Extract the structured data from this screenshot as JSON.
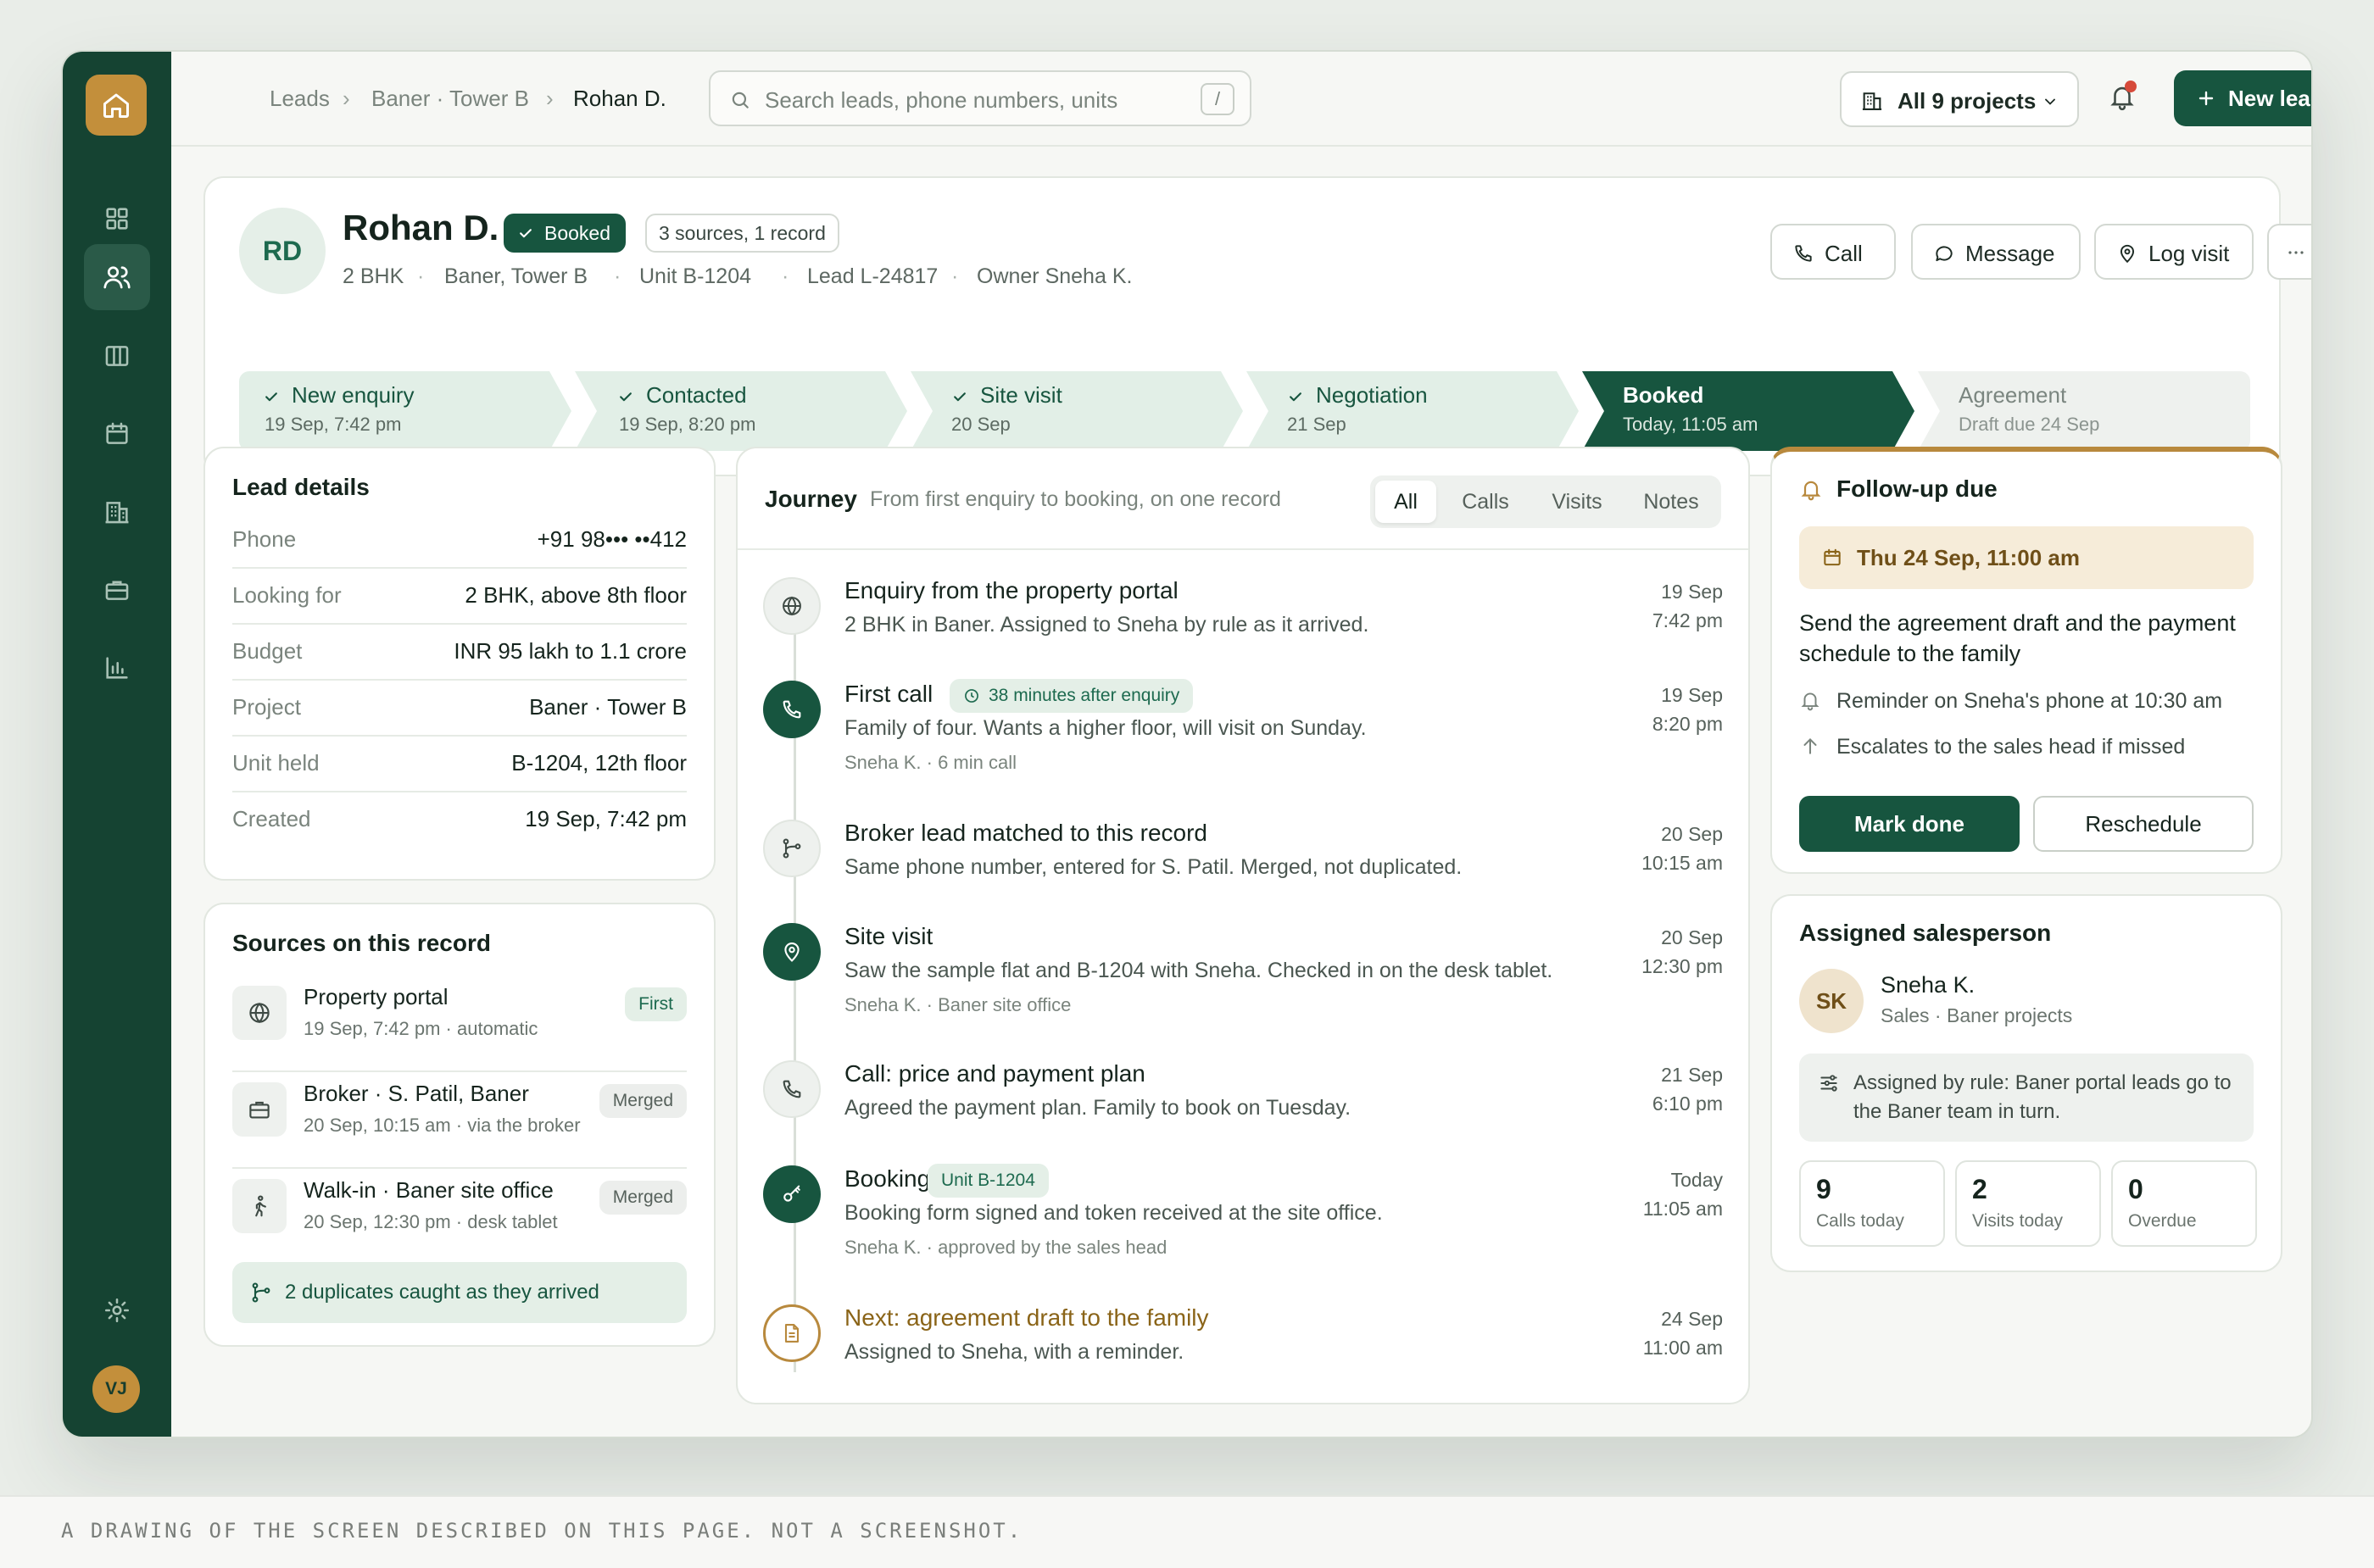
{
  "breadcrumb": [
    "Leads",
    "Baner · Tower B",
    "Rohan D."
  ],
  "search": {
    "placeholder": "Search leads, phone numbers, units",
    "shortcut": "/"
  },
  "projects_button": "All 9 projects",
  "new_lead_button": "New lead",
  "sidebar": {
    "icons": [
      "home-icon",
      "dashboard-icon",
      "leads-icon",
      "board-icon",
      "calendar-icon",
      "building-icon",
      "briefcase-icon",
      "chart-icon",
      "settings-icon"
    ],
    "active": "leads-icon",
    "avatar": "VJ"
  },
  "colors": {
    "brand": "#17553f",
    "rail": "#154332",
    "accent_gold": "#c38f3b",
    "alert": "#d64a3a"
  },
  "lead": {
    "initials": "RD",
    "name": "Rohan D.",
    "status": "Booked",
    "sources_badge": "3 sources, 1 record",
    "meta": [
      "2 BHK",
      "Baner, Tower B",
      "Unit B-1204",
      "Lead L-24817",
      "Owner Sneha K."
    ],
    "actions": [
      "Call",
      "Message",
      "Log visit"
    ]
  },
  "stages": [
    {
      "label": "New enquiry",
      "sub": "19 Sep, 7:42 pm",
      "state": "done"
    },
    {
      "label": "Contacted",
      "sub": "19 Sep, 8:20 pm",
      "state": "done"
    },
    {
      "label": "Site visit",
      "sub": "20 Sep",
      "state": "done"
    },
    {
      "label": "Negotiation",
      "sub": "21 Sep",
      "state": "done"
    },
    {
      "label": "Booked",
      "sub": "Today, 11:05 am",
      "state": "current"
    },
    {
      "label": "Agreement",
      "sub": "Draft due 24 Sep",
      "state": "future"
    }
  ],
  "lead_details": {
    "title": "Lead details",
    "rows": [
      {
        "k": "Phone",
        "v": "+91 98••• ••412"
      },
      {
        "k": "Looking for",
        "v": "2 BHK, above 8th floor"
      },
      {
        "k": "Budget",
        "v": "INR 95 lakh to 1.1 crore"
      },
      {
        "k": "Project",
        "v": "Baner · Tower B"
      },
      {
        "k": "Unit held",
        "v": "B-1204, 12th floor"
      },
      {
        "k": "Created",
        "v": "19 Sep, 7:42 pm"
      }
    ]
  },
  "sources": {
    "title": "Sources on this record",
    "items": [
      {
        "title": "Property portal",
        "sub": "19 Sep, 7:42 pm · automatic",
        "tag": "First",
        "icon": "globe-icon"
      },
      {
        "title": "Broker · S. Patil, Baner",
        "sub": "20 Sep, 10:15 am · via the broker",
        "tag": "Merged",
        "icon": "briefcase-icon"
      },
      {
        "title": "Walk-in · Baner site office",
        "sub": "20 Sep, 12:30 pm · desk tablet",
        "tag": "Merged",
        "icon": "walk-icon"
      }
    ],
    "duplicates_note": "2 duplicates caught as they arrived"
  },
  "journey": {
    "title": "Journey",
    "subtitle": "From first enquiry to booking, on one record",
    "tabs": [
      "All",
      "Calls",
      "Visits",
      "Notes"
    ],
    "active_tab": "All",
    "events": [
      {
        "title": "Enquiry from the property portal",
        "desc": "2 BHK in Baner. Assigned to Sneha by rule as it arrived.",
        "meta": "",
        "date": "19 Sep",
        "time": "7:42 pm",
        "chip": ""
      },
      {
        "title": "First call",
        "desc": "Family of four. Wants a higher floor, will visit on Sunday.",
        "meta": "Sneha K. · 6 min call",
        "date": "19 Sep",
        "time": "8:20 pm",
        "chip": "38 minutes after enquiry"
      },
      {
        "title": "Broker lead matched to this record",
        "desc": "Same phone number, entered for S. Patil. Merged, not duplicated.",
        "meta": "",
        "date": "20 Sep",
        "time": "10:15 am",
        "chip": ""
      },
      {
        "title": "Site visit",
        "desc": "Saw the sample flat and B-1204 with Sneha. Checked in on the desk tablet.",
        "meta": "Sneha K. · Baner site office",
        "date": "20 Sep",
        "time": "12:30 pm",
        "chip": ""
      },
      {
        "title": "Call: price and payment plan",
        "desc": "Agreed the payment plan. Family to book on Tuesday.",
        "meta": "",
        "date": "21 Sep",
        "time": "6:10 pm",
        "chip": ""
      },
      {
        "title": "Booking",
        "desc": "Booking form signed and token received at the site office.",
        "meta": "Sneha K. · approved by the sales head",
        "date": "Today",
        "time": "11:05 am",
        "chip": "Unit B-1204"
      },
      {
        "title": "Next: agreement draft to the family",
        "desc": "Assigned to Sneha, with a reminder.",
        "meta": "",
        "date": "24 Sep",
        "time": "11:00 am",
        "chip": ""
      }
    ]
  },
  "followup": {
    "title": "Follow-up due",
    "date": "Thu 24 Sep, 11:00 am",
    "body": "Send the agreement draft and the payment schedule to the family",
    "reminder": "Reminder on Sneha's phone at 10:30 am",
    "escalate": "Escalates to the sales head if missed",
    "done": "Mark done",
    "reschedule": "Reschedule"
  },
  "assigned": {
    "title": "Assigned salesperson",
    "initials": "SK",
    "name": "Sneha K.",
    "role": "Sales · Baner projects",
    "rule": "Assigned by rule: Baner portal leads go to the Baner team in turn.",
    "stats": [
      {
        "n": "9",
        "l": "Calls today"
      },
      {
        "n": "2",
        "l": "Visits today"
      },
      {
        "n": "0",
        "l": "Overdue"
      }
    ]
  },
  "caption": "A DRAWING OF THE SCREEN DESCRIBED ON THIS PAGE. NOT A SCREENSHOT."
}
